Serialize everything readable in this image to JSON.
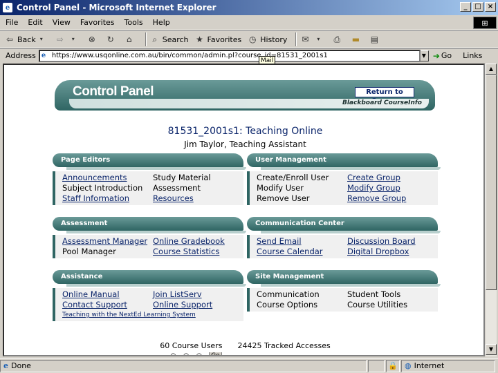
{
  "window": {
    "title": "Control Panel - Microsoft Internet Explorer",
    "min": "_",
    "max": "□",
    "close": "×"
  },
  "menu": [
    "File",
    "Edit",
    "View",
    "Favorites",
    "Tools",
    "Help"
  ],
  "toolbar": {
    "back": "Back",
    "search": "Search",
    "favorites": "Favorites",
    "history": "History"
  },
  "address": {
    "label": "Address",
    "url": "https://www.usqonline.com.au/bin/common/admin.pl?course_id=81531_2001s1",
    "go": "Go",
    "links": "Links"
  },
  "tooltip": "Mail",
  "page": {
    "header_title": "Control Panel",
    "return_button": "Return to Course",
    "brand": "Blackboard CourseInfo",
    "course_title": "81531_2001s1: Teaching Online",
    "course_sub": "Jim Taylor, Teaching Assistant",
    "panels": {
      "page_editors": {
        "title": "Page Editors",
        "items": [
          {
            "label": "Announcements",
            "link": true
          },
          {
            "label": "Study Material",
            "link": false
          },
          {
            "label": "Subject Introduction",
            "link": false
          },
          {
            "label": "Assessment",
            "link": false
          },
          {
            "label": "Staff Information",
            "link": true
          },
          {
            "label": "Resources",
            "link": true
          }
        ]
      },
      "user_management": {
        "title": "User Management",
        "items": [
          {
            "label": "Create/Enroll User",
            "link": false
          },
          {
            "label": "Create Group",
            "link": true
          },
          {
            "label": "Modify User",
            "link": false
          },
          {
            "label": "Modify Group",
            "link": true
          },
          {
            "label": "Remove User",
            "link": false
          },
          {
            "label": "Remove Group",
            "link": true
          }
        ]
      },
      "assessment": {
        "title": "Assessment",
        "items": [
          {
            "label": "Assessment Manager",
            "link": true
          },
          {
            "label": "Online Gradebook",
            "link": true
          },
          {
            "label": "Pool Manager",
            "link": false
          },
          {
            "label": "Course Statistics",
            "link": true
          }
        ]
      },
      "communication": {
        "title": "Communication Center",
        "items": [
          {
            "label": "Send Email",
            "link": true
          },
          {
            "label": "Discussion Board",
            "link": true
          },
          {
            "label": "Course Calendar",
            "link": true
          },
          {
            "label": "Digital Dropbox",
            "link": true
          }
        ]
      },
      "assistance": {
        "title": "Assistance",
        "items": [
          {
            "label": "Online Manual",
            "link": true
          },
          {
            "label": "Join ListServ",
            "link": true
          },
          {
            "label": "Contact Support",
            "link": true
          },
          {
            "label": "Online Support",
            "link": true
          }
        ],
        "footer_link": "Teaching with the NextEd Learning System"
      },
      "site_management": {
        "title": "Site Management",
        "items": [
          {
            "label": "Communication",
            "link": false
          },
          {
            "label": "Student Tools",
            "link": false
          },
          {
            "label": "Course Options",
            "link": false
          },
          {
            "label": "Course Utilities",
            "link": false
          }
        ]
      }
    },
    "stats": {
      "users": "60 Course Users",
      "accesses": "24425 Tracked Accesses"
    },
    "footer_go": "Go"
  },
  "status": {
    "text": "Done",
    "zone": "Internet"
  }
}
